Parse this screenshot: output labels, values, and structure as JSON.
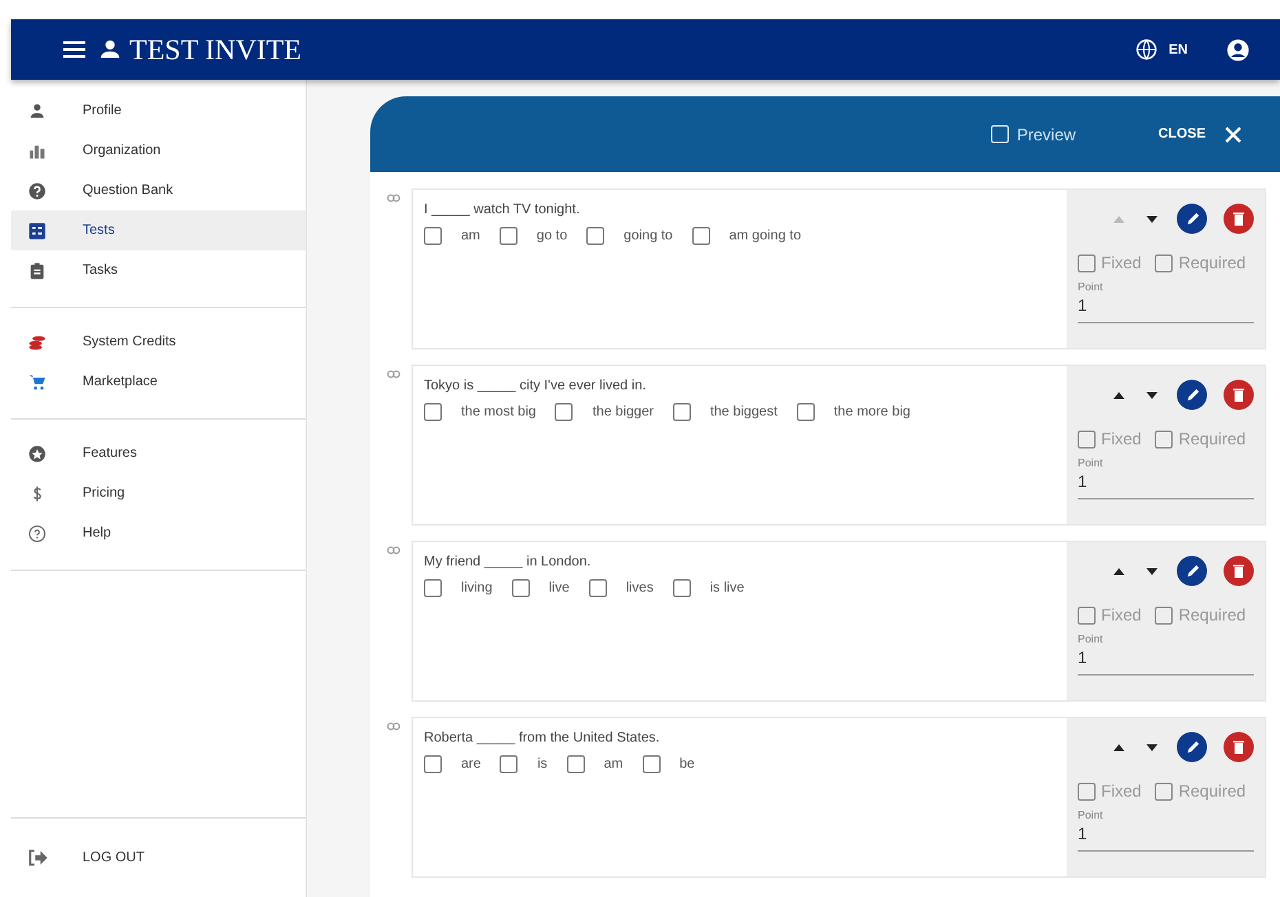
{
  "app": {
    "title": "TEST INVITE",
    "language": "EN"
  },
  "sidebar": {
    "groups": [
      [
        {
          "label": "Profile",
          "selected": false
        },
        {
          "label": "Organization",
          "selected": false
        },
        {
          "label": "Question Bank",
          "selected": false
        },
        {
          "label": "Tests",
          "selected": true
        },
        {
          "label": "Tasks",
          "selected": false
        }
      ],
      [
        {
          "label": "System Credits",
          "selected": false
        },
        {
          "label": "Marketplace",
          "selected": false
        }
      ],
      [
        {
          "label": "Features",
          "selected": false
        },
        {
          "label": "Pricing",
          "selected": false
        },
        {
          "label": "Help",
          "selected": false
        }
      ]
    ],
    "logout": "LOG OUT"
  },
  "dialog": {
    "preview": {
      "label": "Preview",
      "checked": false
    },
    "close": "CLOSE"
  },
  "questions": [
    {
      "text": "I _____ watch TV tonight.",
      "up_disabled": true,
      "options": [
        {
          "label": "am",
          "checked": false
        },
        {
          "label": "go to",
          "checked": false
        },
        {
          "label": "going to",
          "checked": false
        },
        {
          "label": "am going to",
          "checked": false
        }
      ],
      "fixed": {
        "label": "Fixed",
        "checked": false
      },
      "required": {
        "label": "Required",
        "checked": false
      },
      "point_label": "Point",
      "point": "1"
    },
    {
      "text": "Tokyo is _____ city I've ever lived in.",
      "up_disabled": false,
      "options": [
        {
          "label": "the most big",
          "checked": false
        },
        {
          "label": "the bigger",
          "checked": false
        },
        {
          "label": "the biggest",
          "checked": false
        },
        {
          "label": "the more big",
          "checked": false
        }
      ],
      "fixed": {
        "label": "Fixed",
        "checked": false
      },
      "required": {
        "label": "Required",
        "checked": false
      },
      "point_label": "Point",
      "point": "1"
    },
    {
      "text": "My friend _____ in London.",
      "up_disabled": false,
      "options": [
        {
          "label": "living",
          "checked": false
        },
        {
          "label": "live",
          "checked": false
        },
        {
          "label": "lives",
          "checked": false
        },
        {
          "label": "is live",
          "checked": false
        }
      ],
      "fixed": {
        "label": "Fixed",
        "checked": false
      },
      "required": {
        "label": "Required",
        "checked": false
      },
      "point_label": "Point",
      "point": "1"
    },
    {
      "text": "Roberta _____ from the United States.",
      "up_disabled": false,
      "options": [
        {
          "label": "are",
          "checked": false
        },
        {
          "label": "is",
          "checked": false
        },
        {
          "label": "am",
          "checked": false
        },
        {
          "label": "be",
          "checked": false
        }
      ],
      "fixed": {
        "label": "Fixed",
        "checked": false
      },
      "required": {
        "label": "Required",
        "checked": false
      },
      "point_label": "Point",
      "point": "1"
    }
  ]
}
